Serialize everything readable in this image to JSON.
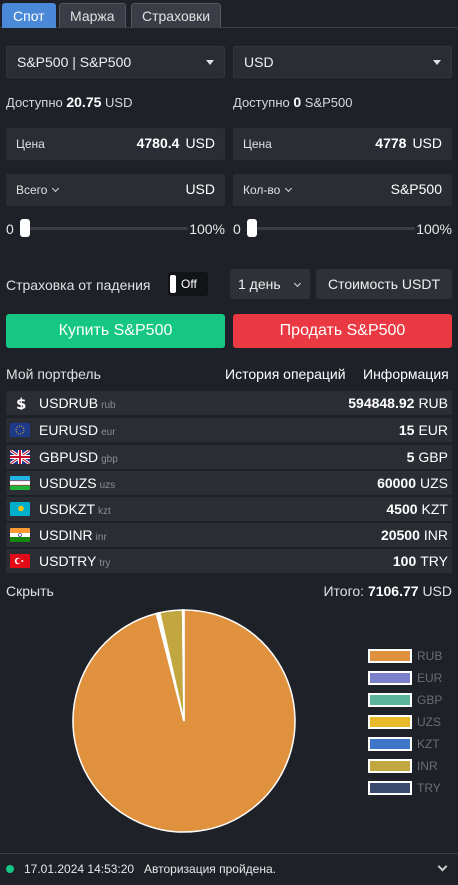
{
  "tabs": [
    {
      "label": "Спот",
      "active": true
    },
    {
      "label": "Маржа",
      "active": false
    },
    {
      "label": "Страховки",
      "active": false
    }
  ],
  "pair_select": "S&P500 | S&P500",
  "currency_select": "USD",
  "left": {
    "available_label": "Доступно",
    "available_amount": "20.75",
    "available_unit": "USD",
    "price_label": "Цена",
    "price_value": "4780.4",
    "price_unit": "USD",
    "total_label": "Всего",
    "total_unit": "USD",
    "slider_min": "0",
    "slider_max": "100%",
    "slider_fraction": 0
  },
  "right": {
    "available_label": "Доступно",
    "available_amount": "0",
    "available_unit": "S&P500",
    "price_label": "Цена",
    "price_value": "4778",
    "price_unit": "USD",
    "qty_label": "Кол-во",
    "qty_unit": "S&P500",
    "slider_min": "0",
    "slider_max": "100%",
    "slider_fraction": 0
  },
  "insurance": {
    "label": "Страховка от падения",
    "toggle": "Off",
    "period": "1 день",
    "cost_button": "Стоимость USDT"
  },
  "buy_label": "Купить S&P500",
  "sell_label": "Продать S&P500",
  "portfolio": {
    "title": "Мой портфель",
    "history_link": "История операций",
    "info_link": "Информация",
    "rows": [
      {
        "name": "USDRUB",
        "code": "rub",
        "amount": "594848.92",
        "unit": "RUB",
        "flag": "dollar-icon"
      },
      {
        "name": "EURUSD",
        "code": "eur",
        "amount": "15",
        "unit": "EUR",
        "flag": "eu-flag-icon"
      },
      {
        "name": "GBPUSD",
        "code": "gbp",
        "amount": "5",
        "unit": "GBP",
        "flag": "uk-flag-icon"
      },
      {
        "name": "USDUZS",
        "code": "uzs",
        "amount": "60000",
        "unit": "UZS",
        "flag": "uz-flag-icon"
      },
      {
        "name": "USDKZT",
        "code": "kzt",
        "amount": "4500",
        "unit": "KZT",
        "flag": "kz-flag-icon"
      },
      {
        "name": "USDINR",
        "code": "inr",
        "amount": "20500",
        "unit": "INR",
        "flag": "in-flag-icon"
      },
      {
        "name": "USDTRY",
        "code": "try",
        "amount": "100",
        "unit": "TRY",
        "flag": "tr-flag-icon"
      }
    ],
    "hide_label": "Скрыть",
    "total_label": "Итого:",
    "total_value": "7106.77",
    "total_unit": "USD"
  },
  "chart_data": {
    "type": "pie",
    "categories": [
      "RUB",
      "EUR",
      "GBP",
      "UZS",
      "KZT",
      "INR",
      "TRY"
    ],
    "values": [
      96.0,
      0.2,
      0.1,
      0.1,
      0.1,
      3.3,
      0.2
    ],
    "colors": [
      "#e0913e",
      "#7a80c9",
      "#5bb59a",
      "#e8b928",
      "#3d78c8",
      "#c2a640",
      "#3a4a6e"
    ],
    "legend_position": "right"
  },
  "status": {
    "timestamp": "17.01.2024 14:53:20",
    "message": "Авторизация пройдена."
  }
}
